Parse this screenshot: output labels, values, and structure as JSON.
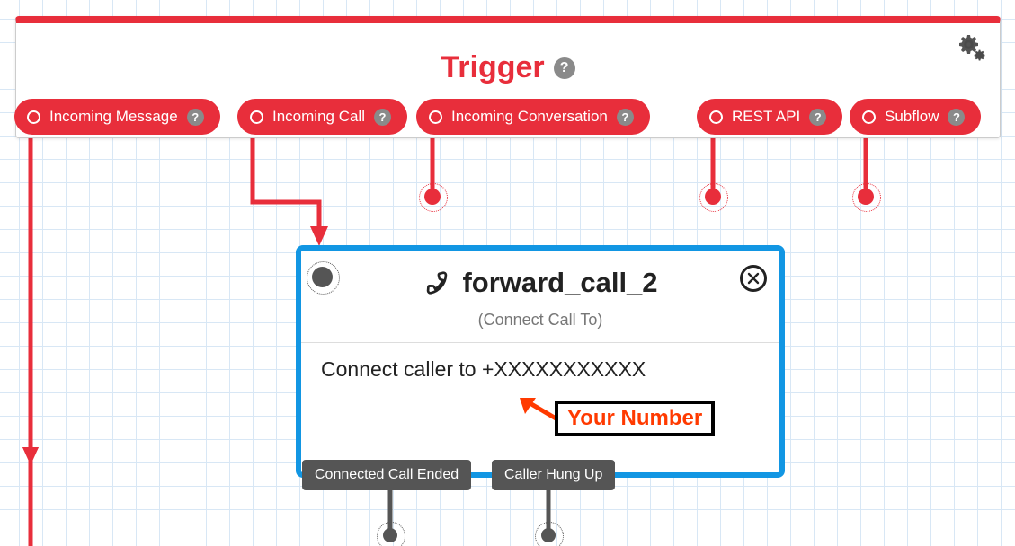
{
  "trigger": {
    "title": "Trigger",
    "outlets": [
      {
        "label": "Incoming Message"
      },
      {
        "label": "Incoming Call"
      },
      {
        "label": "Incoming Conversation"
      },
      {
        "label": "REST API"
      },
      {
        "label": "Subflow"
      }
    ]
  },
  "widget": {
    "title": "forward_call_2",
    "subtitle": "(Connect Call To)",
    "body": "Connect caller to +XXXXXXXXXXX",
    "outlets": [
      {
        "label": "Connected Call Ended"
      },
      {
        "label": "Caller Hung Up"
      }
    ]
  },
  "annotation": {
    "label": "Your Number"
  }
}
